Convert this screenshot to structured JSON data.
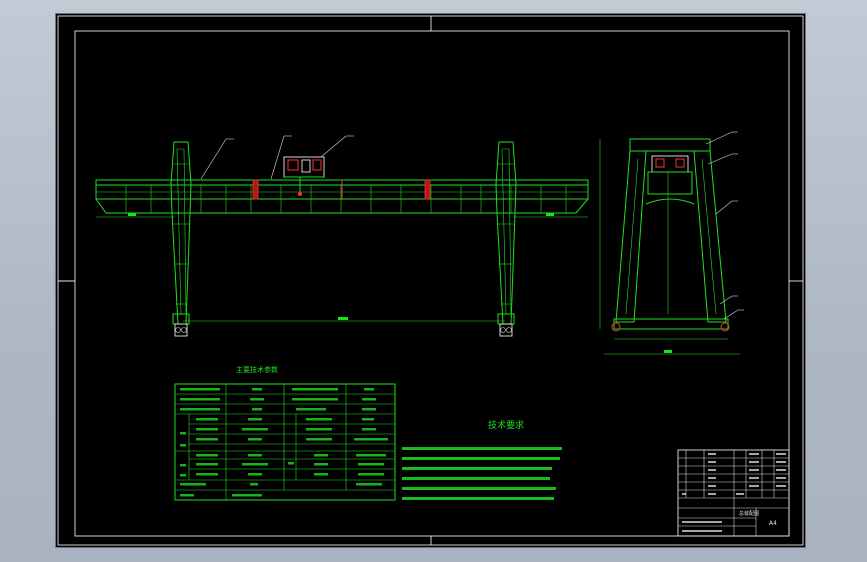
{
  "drawing": {
    "param_table_title": "主要技术参数",
    "tech_req_title": "技术要求",
    "title_block_name": "总装配图",
    "title_block_sheet": "A4",
    "colors": {
      "background": "#000000",
      "lines": "#1fe01f",
      "frame": "#e8e8e8",
      "highlight": "#ff3030"
    }
  }
}
